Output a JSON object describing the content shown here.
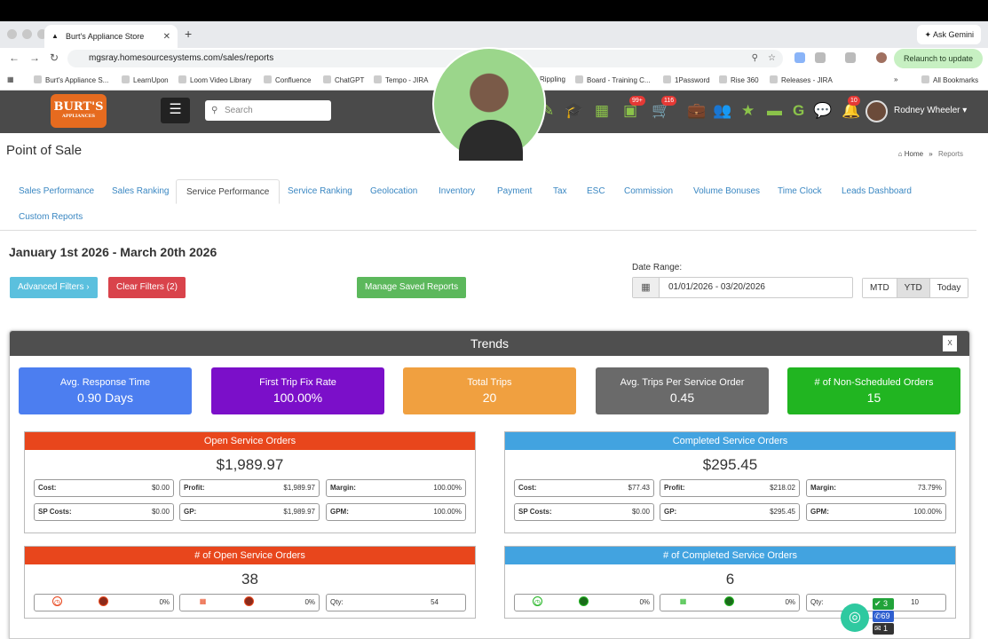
{
  "browser": {
    "tab_title": "Burt's Appliance Store",
    "new_tab": "+",
    "ask_gemini": "Ask Gemini",
    "url": "mgsray.homesourcesystems.com/sales/reports",
    "relaunch": "Relaunch to update",
    "bookmarks": [
      "Burt's Appliance S...",
      "LearnUpon",
      "Loom Video Library",
      "Confluence",
      "ChatGPT",
      "Tempo - JIRA",
      "Rippling",
      "Board - Training C...",
      "1Password",
      "Rise 360",
      "Releases - JIRA"
    ],
    "all_bookmarks": "All Bookmarks"
  },
  "appnav": {
    "logo_text": "BURT'S",
    "logo_sub": "APPLIANCES",
    "search_placeholder": "Search",
    "badge_packages": "99+",
    "badge_cart": "116",
    "badge_bell": "10",
    "user_name": "Rodney Wheeler"
  },
  "page": {
    "title": "Point of Sale",
    "breadcrumb_home": "Home",
    "breadcrumb_current": "Reports",
    "tabs": [
      "Sales Performance",
      "Sales Ranking",
      "Service Performance",
      "Service Ranking",
      "Geolocation",
      "Inventory",
      "Payment",
      "Tax",
      "ESC",
      "Commission",
      "Volume Bonuses",
      "Time Clock",
      "Leads Dashboard",
      "Custom Reports"
    ],
    "active_tab": "Service Performance",
    "date_heading": "January 1st 2026 - March 20th 2026",
    "advanced_filters": "Advanced Filters",
    "clear_filters": "Clear Filters (2)",
    "manage_saved": "Manage Saved Reports",
    "date_range_label": "Date Range:",
    "date_range_value": "01/01/2026 - 03/20/2026",
    "range_buttons": [
      "MTD",
      "YTD",
      "Today"
    ],
    "active_range": "YTD"
  },
  "trends": {
    "title": "Trends",
    "kpis": [
      {
        "label": "Avg. Response Time",
        "value": "0.90 Days",
        "color": "#4c7ef0"
      },
      {
        "label": "First Trip Fix Rate",
        "value": "100.00%",
        "color": "#7b0fc9"
      },
      {
        "label": "Total Trips",
        "value": "20",
        "color": "#f0a040"
      },
      {
        "label": "Avg. Trips Per Service Order",
        "value": "0.45",
        "color": "#6a6a6a"
      },
      {
        "label": "# of Non-Scheduled Orders",
        "value": "15",
        "color": "#21b521"
      }
    ],
    "open_orders": {
      "title": "Open Service Orders",
      "total": "$1,989.97",
      "cost": "$0.00",
      "profit": "$1,989.97",
      "margin": "100.00%",
      "sp_costs": "$0.00",
      "gp": "$1,989.97",
      "gpm": "100.00%"
    },
    "completed_orders": {
      "title": "Completed Service Orders",
      "total": "$295.45",
      "cost": "$77.43",
      "profit": "$218.02",
      "margin": "73.79%",
      "sp_costs": "$0.00",
      "gp": "$295.45",
      "gpm": "100.00%"
    },
    "open_count": {
      "title": "# of Open Service Orders",
      "count": "38",
      "pct1": "0%",
      "pct2": "0%",
      "qty_label": "Qty:",
      "qty": "54"
    },
    "completed_count": {
      "title": "# of Completed Service Orders",
      "count": "6",
      "pct1": "0%",
      "pct2": "0%",
      "qty_label": "Qty:",
      "qty": "10"
    },
    "labels": {
      "cost": "Cost:",
      "profit": "Profit:",
      "margin": "Margin:",
      "sp_costs": "SP Costs:",
      "gp": "GP:",
      "gpm": "GPM:"
    }
  },
  "chat_widget": {
    "checks": "3",
    "calls": "69",
    "messages": "1"
  }
}
